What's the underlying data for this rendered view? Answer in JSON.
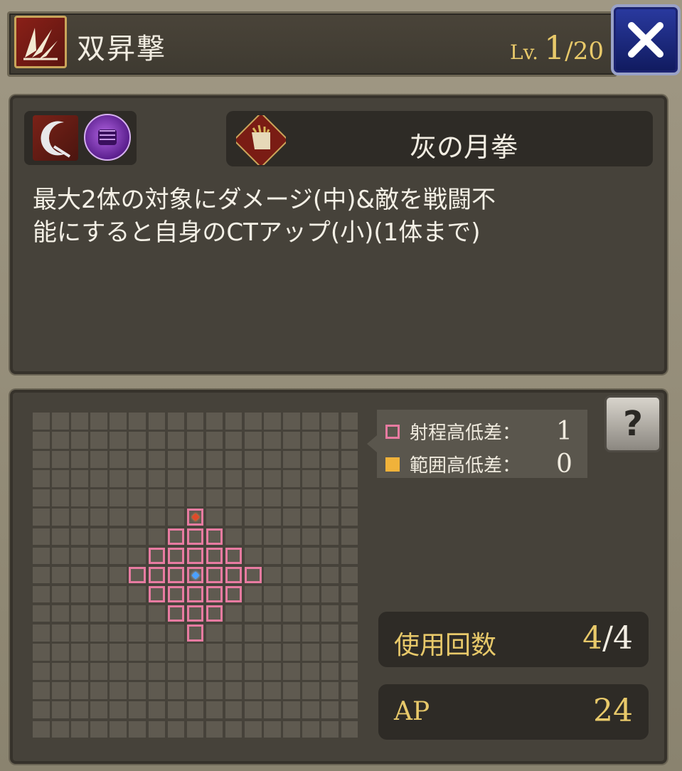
{
  "header": {
    "skill_name": "双昇撃",
    "level_prefix": "Lv.",
    "level_current": "1",
    "level_max": "/20"
  },
  "weapon": {
    "name": "灰の月拳"
  },
  "description": "最大2体の対象にダメージ(中)&敵を戦闘不\n能にすると自身のCTアップ(小)(1体まで)",
  "legend": {
    "range_height_label": "射程高低差：",
    "range_height_value": "1",
    "area_height_label": "範囲高低差：",
    "area_height_value": "0",
    "range_color": "#e77ba1",
    "area_color": "#f0b23a"
  },
  "help_button": "?",
  "stats": {
    "uses_label": "使用回数",
    "uses_current": "4",
    "uses_max": "/4",
    "ap_label": "AP",
    "ap_value": "24"
  },
  "icons": {
    "skill": "claw-slash-icon",
    "element_1": "crescent-slash-icon",
    "element_2": "fist-icon",
    "weapon": "gauntlet-icon",
    "close": "close-icon",
    "help": "help-book-icon"
  },
  "range_grid": {
    "columns": 17,
    "rows": 17,
    "caster_cell": [
      8,
      8
    ],
    "marker_cell": [
      5,
      8
    ],
    "range_cells": [
      [
        5,
        8
      ],
      [
        6,
        7
      ],
      [
        6,
        8
      ],
      [
        6,
        9
      ],
      [
        7,
        6
      ],
      [
        7,
        7
      ],
      [
        7,
        8
      ],
      [
        7,
        9
      ],
      [
        7,
        10
      ],
      [
        8,
        5
      ],
      [
        8,
        6
      ],
      [
        8,
        7
      ],
      [
        8,
        8
      ],
      [
        8,
        9
      ],
      [
        8,
        10
      ],
      [
        8,
        11
      ],
      [
        9,
        6
      ],
      [
        9,
        7
      ],
      [
        9,
        8
      ],
      [
        9,
        9
      ],
      [
        9,
        10
      ],
      [
        10,
        7
      ],
      [
        10,
        8
      ],
      [
        10,
        9
      ],
      [
        11,
        8
      ]
    ]
  }
}
